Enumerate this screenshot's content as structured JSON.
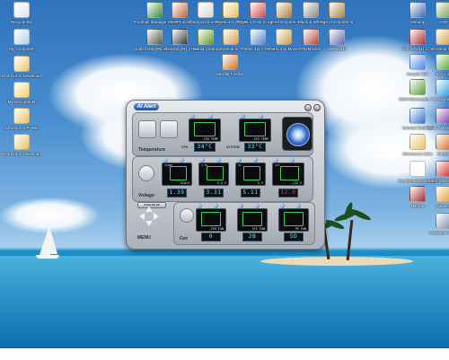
{
  "desktop_icons": [
    {
      "name": "recycle-bin-icon",
      "label": "Recycle Bin",
      "color": "#dce7ef"
    },
    {
      "name": "my-computer-icon",
      "label": "My Computer",
      "color": "#b9d1ea"
    },
    {
      "name": "shortcut-downloads-icon",
      "label": "Shortcut to Downloads(C)",
      "color": "#e8c66a"
    },
    {
      "name": "my-documents-icon",
      "label": "My Documents",
      "color": "#f2d36a"
    },
    {
      "name": "shortcut-pqbe-icon",
      "label": "Shortcut to PQBE",
      "color": "#e9c45c"
    },
    {
      "name": "shortcut-downloads2-icon",
      "label": "Shortcut to Downloads in WD's Fusion",
      "color": "#e9c45c"
    },
    {
      "name": "football-manager-icon",
      "label": "Football Manager 2006",
      "color": "#3a8f3a"
    },
    {
      "name": "pixelplus-icon",
      "label": "PixelPlus (1)",
      "color": "#c46a3b"
    },
    {
      "name": "ashampoo-icon",
      "label": "Ashampoo Burning Studio",
      "color": "#d8d8d8"
    },
    {
      "name": "shortcut-pqbe2-icon",
      "label": "Shortcut to PQBE",
      "color": "#e9c45c"
    },
    {
      "name": "ppsa-icon",
      "label": "PQsa 1.0 ext to 1.0.10",
      "color": "#cc4c4c"
    },
    {
      "name": "age-of-empires-icon",
      "label": "Age of Empires III",
      "color": "#b08440"
    },
    {
      "name": "black-white-icon",
      "label": "Black & White",
      "color": "#8a8a8a"
    },
    {
      "name": "age-of-empires2-icon",
      "label": "Age of Empires III",
      "color": "#b08440"
    },
    {
      "name": "icon-blue",
      "label": "Winamp",
      "color": "#3e6ab0"
    },
    {
      "name": "icon-fw",
      "label": "GWI",
      "color": "#7fa05a"
    },
    {
      "name": "call-of-duty-icon",
      "label": "Call of Duty(R) 2 singleplayer",
      "color": "#5a5a4a"
    },
    {
      "name": "call-of-duty-mp-icon",
      "label": "Call of Duty(R) 2 Multiplayer",
      "color": "#3a3a3a"
    },
    {
      "name": "nvidia-icon",
      "label": "Nvidia Control",
      "color": "#6a9a2a"
    },
    {
      "name": "shortcut-icon",
      "label": "Shortcut to ...",
      "color": "#d2a04a"
    },
    {
      "name": "theme-icon",
      "label": "Theme 1st + PLUS",
      "color": "#5b86c9"
    },
    {
      "name": "movies-icon",
      "label": "Shortcut to Movies",
      "color": "#c9a24a"
    },
    {
      "name": "theme2-icon",
      "label": "TheMovies",
      "color": "#b44a3a"
    },
    {
      "name": "unreal-icon",
      "label": "UnReal(1)",
      "color": "#6a6aa8"
    },
    {
      "name": "redcard-icon",
      "label": "Red Card(1) 2 (1)",
      "color": "#b03030"
    },
    {
      "name": "shortcut2-icon",
      "label": "Shortcut to ...",
      "color": "#d2a04a"
    },
    {
      "name": "mozilla-icon",
      "label": "Mozilla Firefox",
      "color": "#d2742a"
    },
    {
      "name": "google-icon",
      "label": "Google Talk",
      "color": "#4a86e8"
    },
    {
      "name": "icq-icon",
      "label": "ICQ Lite",
      "color": "#5aa83a"
    },
    {
      "name": "skype-icon",
      "label": "Skype",
      "color": "#30a0e0"
    },
    {
      "name": "msn-icon",
      "label": "MSN Messenger 7.5",
      "color": "#5a9e3a"
    },
    {
      "name": "yahoo-icon",
      "label": "Yahoo! Messenger",
      "color": "#7b3fa8"
    },
    {
      "name": "ie-icon",
      "label": "Internet Explorer",
      "color": "#3a72c8"
    },
    {
      "name": "shortcut-ocs-icon",
      "label": "Shortcut to OCS",
      "color": "#e9c45c"
    },
    {
      "name": "firefox-icon",
      "label": "Firefox",
      "color": "#d2742a"
    },
    {
      "name": "soccer-icon",
      "label": "Pro Evolution Soccer",
      "color": "#ffffff"
    },
    {
      "name": "nero-icon",
      "label": "Nero StartSmart",
      "color": "#d03030"
    },
    {
      "name": "winamp-icon",
      "label": "Winamp",
      "color": "#e0a030"
    },
    {
      "name": "hiring-icon",
      "label": "Hitman",
      "color": "#aa2a2a"
    },
    {
      "name": "daemon-icon",
      "label": "DAEMON Tools",
      "color": "#8090b0"
    }
  ],
  "alert": {
    "logo": "AI Alert",
    "temperature": {
      "title": "Temperature",
      "gauges": [
        {
          "caption": "CPU TEMP",
          "label": "CPU",
          "value": "34°C"
        },
        {
          "caption": "SYS TEMP",
          "label": "SYSTEM",
          "value": "33°C"
        }
      ]
    },
    "voltage": {
      "title": "Voltage",
      "gauges": [
        {
          "top": "VCORE",
          "caption": "Vcore",
          "value": "1.39",
          "alert": false
        },
        {
          "top": "3.3V",
          "caption": "3.3 V",
          "value": "3.31",
          "alert": false
        },
        {
          "top": "5V",
          "caption": "5 V",
          "value": "5.11",
          "alert": false
        },
        {
          "top": "12V",
          "caption": "+12 V",
          "value": "12.0",
          "alert": true
        }
      ]
    },
    "fan": {
      "title": "Fan",
      "cooler_label": "COOLER UP",
      "gauges": [
        {
          "caption": "CPU FAN",
          "value": "0"
        },
        {
          "caption": "SYS FAN",
          "value": "2B"
        },
        {
          "caption": "PS FAN",
          "value": "5D"
        }
      ]
    },
    "menu_label": "MENU",
    "colors": {
      "value_text": "#6fe7ff",
      "alert_text": "#ff3a3a",
      "panel": "#c9cdd3"
    }
  }
}
